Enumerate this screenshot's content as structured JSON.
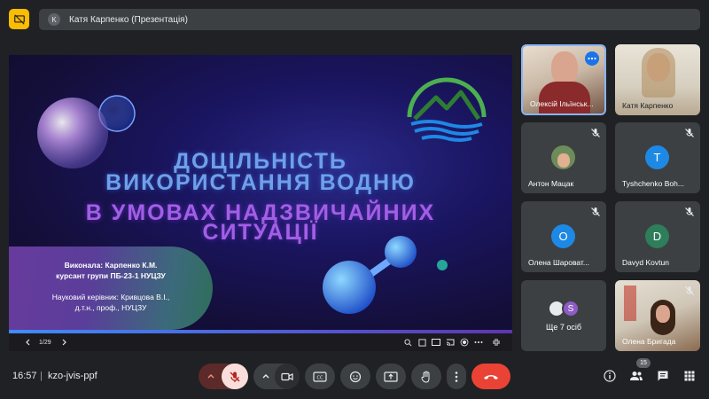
{
  "topbar": {
    "presenter_initial": "K",
    "presenter_label": "Катя Карпенко (Презентація)"
  },
  "slide": {
    "title_line1": "ДОЦІЛЬНІСТЬ",
    "title_line2": "ВИКОРИСТАННЯ ВОДНЮ",
    "title_line3": "В УМОВАХ НАДЗВИЧАЙНИХ",
    "title_line4": "СИТУАЦІЇ",
    "author_line1": "Виконала: Карпенко К.М.",
    "author_line2": "курсант групи ПБ-23-1 НУЦЗУ",
    "author_line3": "Науковий керівник: Кривцова В.І.,",
    "author_line4": "д.т.н., проф., НУЦЗУ",
    "page_indicator": "1/29"
  },
  "participants": [
    {
      "name": "Олексій Ільїнськ...",
      "type": "video",
      "muted": false
    },
    {
      "name": "Катя Карпенко",
      "type": "video",
      "muted": false
    },
    {
      "name": "Антон Мацак",
      "type": "photo",
      "muted": true
    },
    {
      "name": "Tyshchenko Boh...",
      "type": "initial",
      "initial": "T",
      "color": "#1e88e5",
      "muted": true
    },
    {
      "name": "Олена Шароват...",
      "type": "initial",
      "initial": "О",
      "color": "#1e88e5",
      "muted": true
    },
    {
      "name": "Davyd Kovtun",
      "type": "initial",
      "initial": "D",
      "color": "#2e7d5b",
      "muted": true
    },
    {
      "name": "Ще 7 осіб",
      "type": "group",
      "initial": "S",
      "color": "#8e5cc4",
      "muted": false
    },
    {
      "name": "Олена Бригада",
      "type": "video",
      "muted": true
    }
  ],
  "bottombar": {
    "time": "16:57",
    "meeting_code": "kzo-jvis-ppf",
    "participant_count": "15"
  },
  "colors": {
    "background": "#202124",
    "surface": "#3c4043",
    "end_call": "#ea4335",
    "muted_mic": "#f28b82",
    "accent_blue": "#8ab4f8"
  }
}
